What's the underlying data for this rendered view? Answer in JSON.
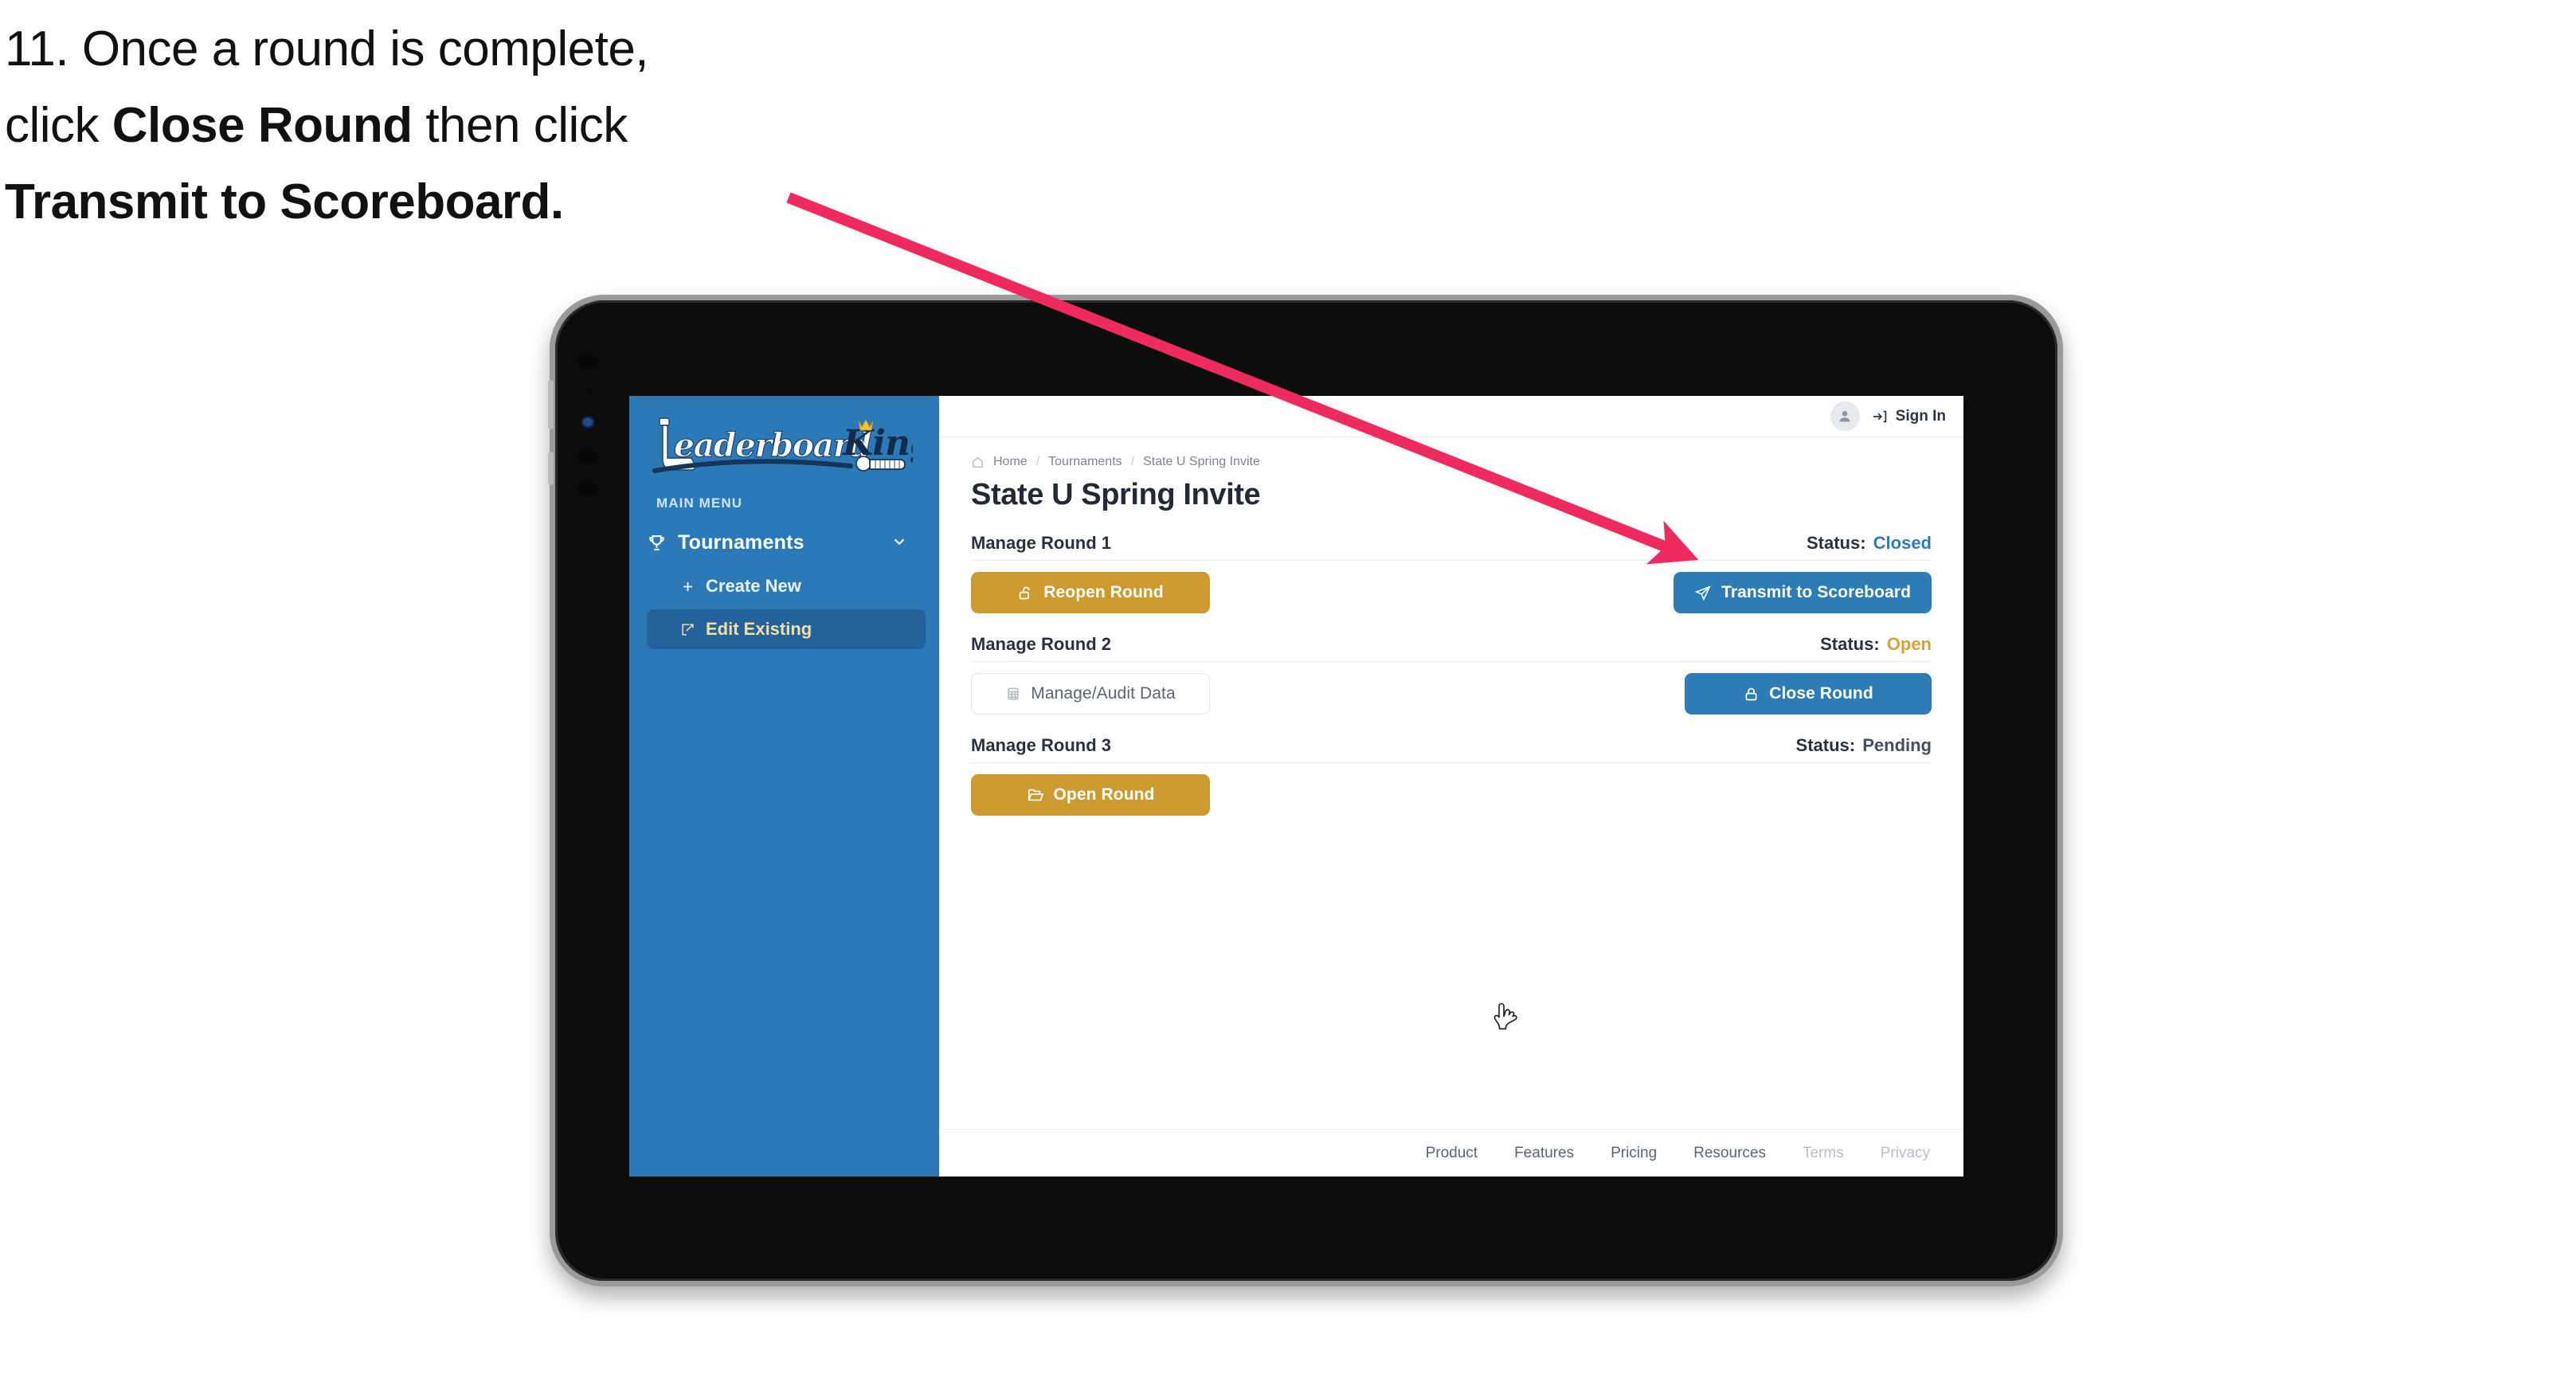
{
  "caption": {
    "line1_plain": "11. Once a round is complete,",
    "line2_a": "click ",
    "line2_bold": "Close Round",
    "line2_b": " then click",
    "line3_bold": "Transmit to Scoreboard."
  },
  "annotation": {
    "arrow_color": "#ee2a5f",
    "arrow_start": "990,248",
    "arrow_end": "2120,700",
    "points_to": "Transmit to Scoreboard"
  },
  "sidebar": {
    "brand_primary": "Leaderboard",
    "brand_secondary": "King",
    "section_label": "MAIN MENU",
    "parent": {
      "label": "Tournaments",
      "icon": "trophy-icon",
      "chevron": "chevron-down-icon"
    },
    "items": [
      {
        "label": "Create New",
        "icon": "plus-icon",
        "active": false
      },
      {
        "label": "Edit Existing",
        "icon": "edit-square-icon",
        "active": true
      }
    ],
    "bg_color": "#2c79b8",
    "active_bg_color": "#23629b",
    "active_text_color": "#f3dfa4"
  },
  "topbar": {
    "avatar_icon": "user-avatar-icon",
    "signin_icon": "sign-in-arrow-icon",
    "signin_label": "Sign In"
  },
  "breadcrumb": {
    "home_icon": "home-icon",
    "items": [
      "Home",
      "Tournaments",
      "State U Spring Invite"
    ],
    "separator": "/"
  },
  "page": {
    "title": "State U Spring Invite"
  },
  "rounds": [
    {
      "title": "Manage Round 1",
      "status_label": "Status:",
      "status_value": "Closed",
      "status_tone": "closed",
      "left_button": {
        "label": "Reopen Round",
        "icon": "unlock-icon",
        "style": "gold"
      },
      "right_button": {
        "label": "Transmit to Scoreboard",
        "icon": "paper-plane-icon",
        "style": "blue"
      }
    },
    {
      "title": "Manage Round 2",
      "status_label": "Status:",
      "status_value": "Open",
      "status_tone": "open",
      "left_button": {
        "label": "Manage/Audit Data",
        "icon": "table-grid-icon",
        "style": "ghost"
      },
      "right_button": {
        "label": "Close Round",
        "icon": "lock-icon",
        "style": "blue"
      }
    },
    {
      "title": "Manage Round 3",
      "status_label": "Status:",
      "status_value": "Pending",
      "status_tone": "pending",
      "left_button": {
        "label": "Open Round",
        "icon": "open-folder-icon",
        "style": "gold"
      },
      "right_button": null
    }
  ],
  "footer": {
    "links": [
      {
        "label": "Product",
        "dim": false
      },
      {
        "label": "Features",
        "dim": false
      },
      {
        "label": "Pricing",
        "dim": false
      },
      {
        "label": "Resources",
        "dim": false
      },
      {
        "label": "Terms",
        "dim": true
      },
      {
        "label": "Privacy",
        "dim": true
      }
    ]
  },
  "cursor": {
    "type": "pointing-hand-cursor"
  },
  "colors": {
    "gold": "#cd9a2f",
    "blue": "#2e7cb5",
    "sidebar_blue": "#2c79b8",
    "arrow_pink": "#ee2a5f"
  }
}
